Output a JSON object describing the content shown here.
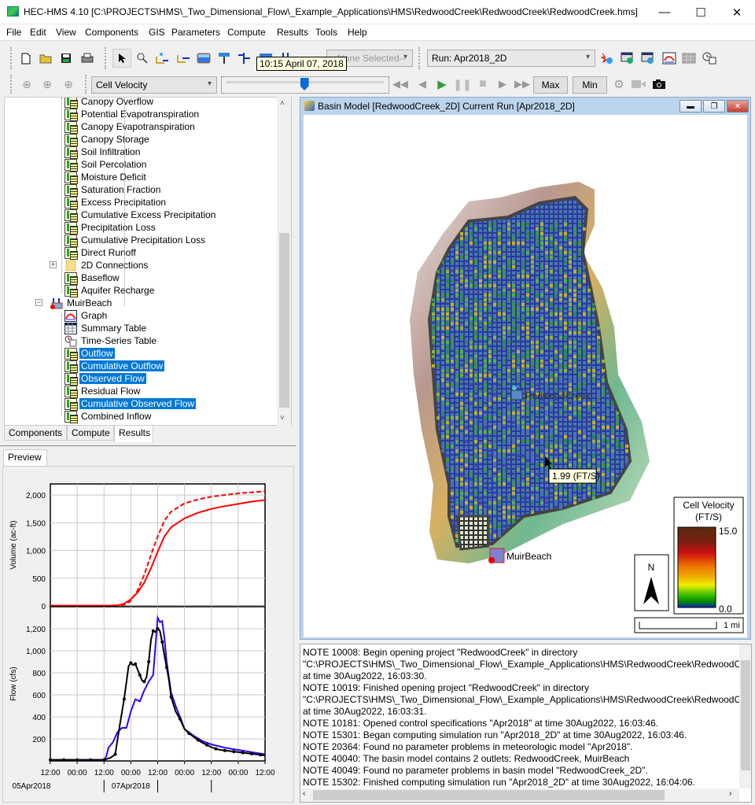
{
  "window": {
    "title": "HEC-HMS 4.10 [C:\\PROJECTS\\HMS\\_Two_Dimensional_Flow\\_Example_Applications\\HMS\\RedwoodCreek\\RedwoodCreek\\RedwoodCreek.hms]",
    "minimize": "—",
    "maximize": "☐",
    "close": "✕"
  },
  "menu": [
    "File",
    "Edit",
    "View",
    "Components",
    "GIS",
    "Parameters",
    "Compute",
    "Results",
    "Tools",
    "Help"
  ],
  "toolbar": {
    "element_combo": "--None Selected--",
    "run_combo": "Run: Apr2018_2D",
    "layer_combo": "Cell Velocity",
    "tooltip": "10:15 April 07, 2018",
    "max_label": "Max",
    "min_label": "Min",
    "slider_position": 0.48
  },
  "tree": {
    "items": [
      {
        "label": "Canopy Overflow",
        "icon": "time-series-icon",
        "level": 2,
        "selected": false
      },
      {
        "label": "Potential Evapotranspiration",
        "icon": "time-series-icon",
        "level": 2,
        "selected": false
      },
      {
        "label": "Canopy Evapotranspiration",
        "icon": "time-series-icon",
        "level": 2,
        "selected": false
      },
      {
        "label": "Canopy Storage",
        "icon": "time-series-icon",
        "level": 2,
        "selected": false
      },
      {
        "label": "Soil Infiltration",
        "icon": "time-series-icon",
        "level": 2,
        "selected": false
      },
      {
        "label": "Soil Percolation",
        "icon": "time-series-icon",
        "level": 2,
        "selected": false
      },
      {
        "label": "Moisture Deficit",
        "icon": "time-series-icon",
        "level": 2,
        "selected": false
      },
      {
        "label": "Saturation Fraction",
        "icon": "time-series-icon",
        "level": 2,
        "selected": false
      },
      {
        "label": "Excess Precipitation",
        "icon": "time-series-icon",
        "level": 2,
        "selected": false
      },
      {
        "label": "Cumulative Excess Precipitation",
        "icon": "time-series-icon",
        "level": 2,
        "selected": false
      },
      {
        "label": "Precipitation Loss",
        "icon": "time-series-icon",
        "level": 2,
        "selected": false
      },
      {
        "label": "Cumulative Precipitation Loss",
        "icon": "time-series-icon",
        "level": 2,
        "selected": false
      },
      {
        "label": "Direct Runoff",
        "icon": "time-series-icon",
        "level": 2,
        "selected": false
      },
      {
        "label": "2D Connections",
        "icon": "folder-icon",
        "level": 2,
        "selected": false,
        "expander": "+"
      },
      {
        "label": "Baseflow",
        "icon": "time-series-icon",
        "level": 2,
        "selected": false
      },
      {
        "label": "Aquifer Recharge",
        "icon": "time-series-icon",
        "level": 2,
        "selected": false
      },
      {
        "label": "MuirBeach",
        "icon": "sink-icon",
        "level": 1,
        "selected": false,
        "expander": "−"
      },
      {
        "label": "Graph",
        "icon": "graph-icon",
        "level": 2,
        "selected": false
      },
      {
        "label": "Summary Table",
        "icon": "table-icon",
        "level": 2,
        "selected": false
      },
      {
        "label": "Time-Series Table",
        "icon": "clock-table-icon",
        "level": 2,
        "selected": false
      },
      {
        "label": "Outflow",
        "icon": "time-series-icon",
        "level": 2,
        "selected": true
      },
      {
        "label": "Cumulative Outflow",
        "icon": "time-series-icon",
        "level": 2,
        "selected": true
      },
      {
        "label": "Observed Flow",
        "icon": "time-series-icon",
        "level": 2,
        "selected": true
      },
      {
        "label": "Residual Flow",
        "icon": "time-series-icon",
        "level": 2,
        "selected": false
      },
      {
        "label": "Cumulative Observed Flow",
        "icon": "time-series-icon",
        "level": 2,
        "selected": true
      },
      {
        "label": "Combined Inflow",
        "icon": "time-series-icon",
        "level": 2,
        "selected": false
      }
    ],
    "tabs": [
      "Components",
      "Compute",
      "Results"
    ],
    "active_tab": "Results"
  },
  "preview": {
    "tab": "Preview"
  },
  "chart_data": [
    {
      "type": "line",
      "title": "",
      "xlabel": "",
      "ylabel": "Volume (ac-ft)",
      "ylim": [
        0,
        2200
      ],
      "yticks": [
        0,
        500,
        1000,
        1500,
        2000
      ],
      "ytick_labels": [
        "0",
        "500",
        "1,000",
        "1,500",
        "2,000"
      ],
      "x_hours": [
        0,
        12,
        24,
        36,
        48,
        60,
        72,
        84,
        96
      ],
      "grid": true,
      "series": [
        {
          "name": "Cumulative Outflow",
          "color": "#ff0000",
          "style": "solid",
          "x": [
            0,
            12,
            24,
            30,
            33,
            36,
            39,
            42,
            45,
            48,
            51,
            54,
            60,
            66,
            72,
            78,
            84,
            90,
            96
          ],
          "y": [
            5,
            5,
            5,
            10,
            40,
            120,
            240,
            420,
            680,
            980,
            1250,
            1420,
            1580,
            1680,
            1750,
            1800,
            1840,
            1880,
            1910
          ]
        },
        {
          "name": "Cumulative Observed Flow",
          "color": "#ff0000",
          "style": "dashed",
          "x": [
            0,
            12,
            24,
            30,
            33,
            36,
            39,
            42,
            45,
            48,
            51,
            54,
            60,
            66,
            72,
            78,
            84,
            90,
            96
          ],
          "y": [
            5,
            5,
            5,
            5,
            15,
            90,
            280,
            560,
            920,
            1250,
            1540,
            1700,
            1850,
            1920,
            1970,
            2000,
            2030,
            2050,
            2070
          ]
        }
      ]
    },
    {
      "type": "line",
      "title": "",
      "xlabel": "",
      "ylabel": "Flow (cfs)",
      "ylim": [
        0,
        1400
      ],
      "yticks": [
        200,
        400,
        600,
        800,
        1000,
        1200
      ],
      "ytick_labels": [
        "200",
        "400",
        "600",
        "800",
        "1,000",
        "1,200"
      ],
      "xtick_labels": [
        "12:00",
        "00:00",
        "12:00",
        "00:00",
        "12:00",
        "00:00",
        "12:00",
        "00:00",
        "12:00"
      ],
      "date_labels": [
        "05Apr2018",
        "07Apr2018"
      ],
      "grid": true,
      "series": [
        {
          "name": "Outflow",
          "color": "#3300ff",
          "style": "solid",
          "x": [
            0,
            6,
            12,
            18,
            24,
            25,
            26,
            28,
            30,
            32,
            34,
            36,
            38,
            40,
            42,
            44,
            46,
            48,
            49,
            50,
            51,
            52,
            54,
            56,
            58,
            60,
            64,
            68,
            72,
            78,
            84,
            90,
            96
          ],
          "y": [
            10,
            10,
            10,
            10,
            10,
            40,
            120,
            170,
            260,
            300,
            300,
            450,
            560,
            540,
            640,
            720,
            780,
            1300,
            1260,
            1270,
            1120,
            900,
            620,
            500,
            400,
            290,
            230,
            180,
            150,
            120,
            100,
            80,
            60
          ]
        },
        {
          "name": "Observed Flow",
          "color": "#000000",
          "style": "solid",
          "markers": true,
          "x": [
            0,
            3,
            6,
            9,
            12,
            15,
            18,
            21,
            24,
            27,
            29,
            31,
            33,
            35,
            36,
            37,
            38,
            39,
            40,
            41,
            42,
            43,
            44,
            45,
            46,
            47,
            48,
            49,
            50,
            51,
            52,
            53,
            54,
            56,
            58,
            60,
            62,
            64,
            66,
            68,
            70,
            72,
            74,
            76,
            78,
            80,
            82,
            84,
            86,
            88,
            90,
            92,
            94,
            96
          ],
          "y": [
            10,
            10,
            10,
            10,
            10,
            10,
            10,
            10,
            10,
            30,
            60,
            320,
            560,
            860,
            890,
            870,
            880,
            830,
            780,
            730,
            720,
            760,
            900,
            1100,
            1180,
            1170,
            1200,
            1180,
            1080,
            960,
            850,
            740,
            580,
            450,
            380,
            290,
            250,
            220,
            190,
            165,
            145,
            125,
            110,
            100,
            95,
            90,
            85,
            80,
            75,
            70,
            65,
            60,
            55,
            50
          ]
        }
      ]
    }
  ],
  "basin_window": {
    "title": "Basin Model [RedwoodCreek_2D] Current Run [Apr2018_2D]",
    "labels": {
      "redwood": "RedwoodCreek",
      "muir": "MuirBeach",
      "cell_tooltip": "1.99 (FT/S)"
    },
    "legend": {
      "title": "Cell Velocity",
      "units": "(FT/S)",
      "max": "15.0",
      "min": "0.0",
      "colors": [
        "#5a2a10",
        "#8a1a10",
        "#cc1010",
        "#ee6600",
        "#f0a000",
        "#e8e800",
        "#40c000",
        "#009000",
        "#1020c0"
      ]
    },
    "north_label": "N",
    "scale_label": "1 mi"
  },
  "log": {
    "lines": [
      "NOTE 10008:  Begin opening project \"RedwoodCreek\" in directory",
      "\"C:\\PROJECTS\\HMS\\_Two_Dimensional_Flow\\_Example_Applications\\HMS\\RedwoodCreek\\RedwoodCreek\"",
      " at time 30Aug2022, 16:03:30.",
      "NOTE 10019:  Finished opening project \"RedwoodCreek\" in directory",
      "\"C:\\PROJECTS\\HMS\\_Two_Dimensional_Flow\\_Example_Applications\\HMS\\RedwoodCreek\\RedwoodCreek\"",
      " at time 30Aug2022, 16:03:31.",
      "NOTE 10181:  Opened control specifications \"Apr2018\" at time 30Aug2022, 16:03:46.",
      "NOTE 15301:  Began computing simulation run \"Apr2018_2D\" at time 30Aug2022, 16:03:46.",
      "NOTE 20364:  Found no parameter problems in meteorologic model \"Apr2018\".",
      "NOTE 40040:  The basin model contains 2 outlets: RedwoodCreek, MuirBeach",
      "NOTE 40049:  Found no parameter problems in basin model \"RedwoodCreek_2D\".",
      "NOTE 15302:  Finished computing simulation run \"Apr2018_2D\" at time 30Aug2022, 16:04:06."
    ]
  }
}
